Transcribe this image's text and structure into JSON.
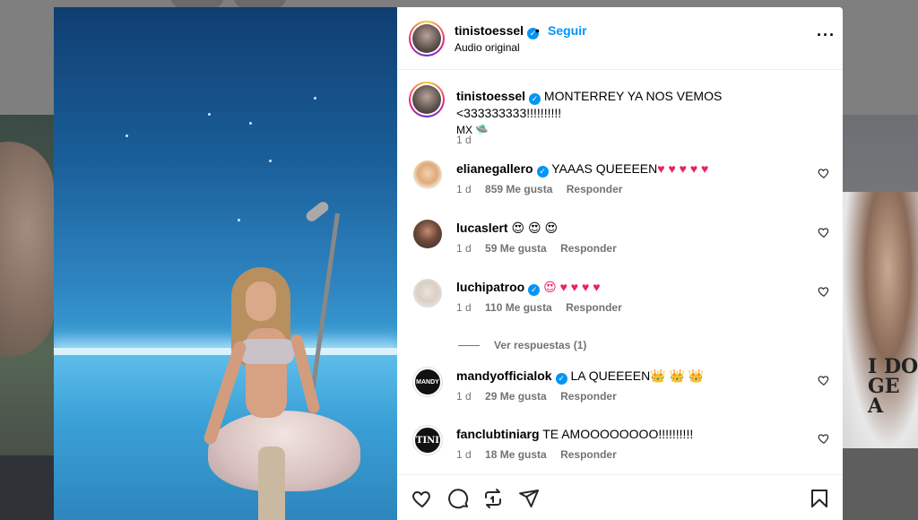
{
  "post": {
    "author": {
      "username": "tinistoessel",
      "verified_icon": "verified-badge-icon",
      "follow_label": "Seguir",
      "separator": "•",
      "subtitle": "Audio original"
    },
    "more_icon": "more-options-icon",
    "caption": {
      "username": "tinistoessel",
      "text": "MONTERREY YA NOS VEMOS <333333333!!!!!!!!!!",
      "line2": "MX 🛸",
      "time": "1 d"
    },
    "comments": [
      {
        "username": "elianegallero",
        "verified": true,
        "text": "YAAAS QUEEEEN",
        "emoji": "♥ ♥ ♥ ♥ ♥",
        "time": "1 d",
        "likes": "859 Me gusta",
        "reply": "Responder",
        "avatar_color": "#e7c9a1"
      },
      {
        "username": "lucaslert",
        "verified": false,
        "text": "",
        "emoji": "😍 😍 😍",
        "time": "1 d",
        "likes": "59 Me gusta",
        "reply": "Responder",
        "avatar_color": "#6e4b3a"
      },
      {
        "username": "luchipatroo",
        "verified": true,
        "text": "",
        "emoji": "😍 ♥ ♥ ♥ ♥",
        "time": "1 d",
        "likes": "110 Me gusta",
        "reply": "Responder",
        "avatar_color": "#e9e4de"
      },
      {
        "username": "mandyofficialok",
        "verified": true,
        "text": "LA QUEEEEN",
        "emoji": "👑 👑 👑",
        "time": "1 d",
        "likes": "29 Me gusta",
        "reply": "Responder",
        "avatar_color": "#1a1a1a"
      },
      {
        "username": "fanclubtiniarg",
        "verified": false,
        "text": "TE AMOOOOOOOO!!!!!!!!!!",
        "emoji": "",
        "time": "1 d",
        "likes": "18 Me gusta",
        "reply": "Responder",
        "avatar_color": "#1a1a1a"
      }
    ],
    "view_replies_label": "Ver respuestas (1)",
    "mandy_avatar_text": "MANDY",
    "tini_avatar_text": "TINI",
    "actions": {
      "like_icon": "heart-icon",
      "comment_icon": "comment-icon",
      "repost_icon": "repost-icon",
      "share_icon": "share-icon",
      "save_icon": "bookmark-icon"
    }
  },
  "background": {
    "shirt_text": "I DO\nGE\nA"
  },
  "colors": {
    "accent": "#0095f6",
    "muted": "#737373",
    "heart_emoji": "#e8245a"
  }
}
